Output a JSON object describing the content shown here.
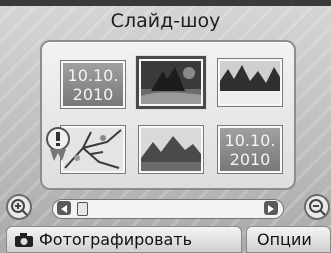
{
  "app": {
    "title": "Слайд-шоу"
  },
  "thumbnails": [
    {
      "kind": "date",
      "date_line1": "10.10.",
      "date_line2": "2010",
      "selected": false
    },
    {
      "kind": "photo",
      "subject": "dark-tree-scene",
      "selected": true
    },
    {
      "kind": "photo",
      "subject": "snow-forest",
      "selected": false
    },
    {
      "kind": "photo",
      "subject": "tree-branches",
      "selected": false
    },
    {
      "kind": "photo",
      "subject": "mountains-landscape",
      "selected": false
    },
    {
      "kind": "date",
      "date_line1": "10.10.",
      "date_line2": "2010",
      "selected": false
    }
  ],
  "scroll": {
    "position": 0.02
  },
  "icons": {
    "zoom_in": "zoom-in-icon",
    "zoom_out": "zoom-out-icon",
    "warning": "warning-icon",
    "camera": "camera-icon"
  },
  "bottom": {
    "shoot_label": "Фотографировать",
    "options_label": "Опции"
  },
  "colors": {
    "background": "#bdbdbd",
    "panel": "#e8e8e8",
    "date_tile": "#8c8c8c"
  }
}
